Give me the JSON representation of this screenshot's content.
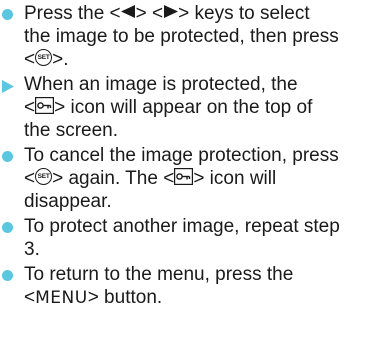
{
  "colors": {
    "bullet": "#5bc6e2",
    "arrow": "#5bc6e2",
    "text": "#1a1a1a"
  },
  "icons": {
    "left_key": "left-triangle-icon",
    "right_key": "right-triangle-icon",
    "set_button": "set-button-icon",
    "protect": "protect-key-icon"
  },
  "items": [
    {
      "marker": "bullet",
      "lines": [
        {
          "t1": "Press the <",
          "t2": "> <",
          "t3": "> keys to select"
        },
        {
          "t1": "the image to be protected, then press"
        },
        {
          "t1": "<",
          "t2": ">.",
          "set_label": "SET"
        }
      ]
    },
    {
      "marker": "arrow",
      "lines": [
        {
          "t1": "When an image is protected, the"
        },
        {
          "t1": "<",
          "t2": "> icon will appear on the top of"
        },
        {
          "t1": "the screen."
        }
      ]
    },
    {
      "marker": "bullet",
      "lines": [
        {
          "t1": "To cancel the image protection, press"
        },
        {
          "t1": "<",
          "t2": "> again. The <",
          "t3": "> icon will",
          "set_label": "SET"
        },
        {
          "t1": "disappear."
        }
      ]
    },
    {
      "marker": "bullet",
      "lines": [
        {
          "t1": "To protect another image, repeat step"
        },
        {
          "t1": "3."
        }
      ]
    },
    {
      "marker": "bullet",
      "lines": [
        {
          "t1": "To return to the menu, press the"
        },
        {
          "t1": "<",
          "menu_word": "MENU",
          "t2": "> button."
        }
      ]
    }
  ]
}
